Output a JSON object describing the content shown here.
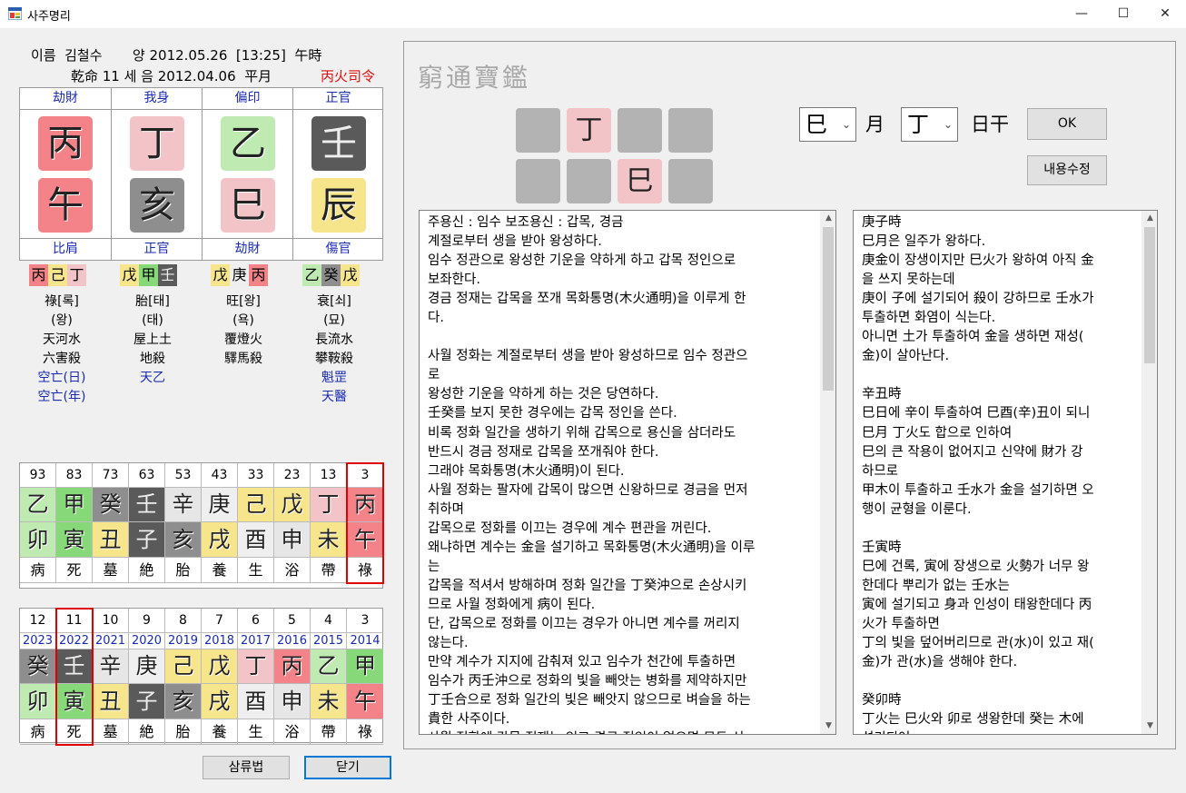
{
  "window": {
    "title": "사주명리",
    "minimize_glyph": "—",
    "maximize_glyph": "☐",
    "close_glyph": "✕"
  },
  "header": {
    "line1": "이름  김철수       양 2012.05.26  [13:25]  午時",
    "line2": "乾命 11 세 음 2012.04.06  平月",
    "line2_right": "丙火司令"
  },
  "pillars": [
    {
      "top": "劫財",
      "stem": "丙",
      "branch": "午",
      "bottom": "比肩",
      "stem_color": "#f38388",
      "branch_color": "#f38388",
      "hidden": [
        {
          "c": "丙",
          "bg": "#f38388"
        },
        {
          "c": "己",
          "bg": "#f6e58a"
        },
        {
          "c": "丁",
          "bg": "#f2c3c7"
        }
      ],
      "info": [
        "祿[록]",
        "(왕)",
        "天河水",
        "六害殺"
      ],
      "info_blue": [
        "空亡(日)",
        "空亡(年)"
      ]
    },
    {
      "top": "我身",
      "stem": "丁",
      "branch": "亥",
      "bottom": "正官",
      "stem_color": "#f2c3c7",
      "branch_color": "#8e8e8e",
      "hidden": [
        {
          "c": "戊",
          "bg": "#f6e58a"
        },
        {
          "c": "甲",
          "bg": "#86d879"
        },
        {
          "c": "壬",
          "bg": "#5a5a5a"
        }
      ],
      "info": [
        "胎[태]",
        "(태)",
        "屋上土",
        "地殺"
      ],
      "info_blue": [
        "天乙"
      ]
    },
    {
      "top": "偏印",
      "stem": "乙",
      "branch": "巳",
      "bottom": "劫財",
      "stem_color": "#bfeab2",
      "branch_color": "#f2c3c7",
      "hidden": [
        {
          "c": "戊",
          "bg": "#f6e58a"
        },
        {
          "c": "庚",
          "bg": "#efefef"
        },
        {
          "c": "丙",
          "bg": "#f38388"
        }
      ],
      "info": [
        "旺[왕]",
        "(욕)",
        "覆燈火",
        "驛馬殺"
      ],
      "info_blue": []
    },
    {
      "top": "正官",
      "stem": "壬",
      "branch": "辰",
      "bottom": "傷官",
      "stem_color": "#5a5a5a",
      "branch_color": "#f6e58a",
      "hidden": [
        {
          "c": "乙",
          "bg": "#bfeab2"
        },
        {
          "c": "癸",
          "bg": "#8e8e8e"
        },
        {
          "c": "戊",
          "bg": "#f6e58a"
        }
      ],
      "info": [
        "衰[쇠]",
        "(묘)",
        "長流水",
        "攀鞍殺"
      ],
      "info_blue": [
        "魁罡",
        "天醫"
      ]
    }
  ],
  "daeun": {
    "ages": [
      "93",
      "83",
      "73",
      "63",
      "53",
      "43",
      "33",
      "23",
      "13",
      "3"
    ],
    "stems": [
      {
        "c": "乙",
        "bg": "#bfeab2"
      },
      {
        "c": "甲",
        "bg": "#86d879"
      },
      {
        "c": "癸",
        "bg": "#8e8e8e"
      },
      {
        "c": "壬",
        "bg": "#5a5a5a"
      },
      {
        "c": "辛",
        "bg": "#e6e6e6"
      },
      {
        "c": "庚",
        "bg": "#efefef"
      },
      {
        "c": "己",
        "bg": "#f6e58a"
      },
      {
        "c": "戊",
        "bg": "#f6e58a"
      },
      {
        "c": "丁",
        "bg": "#f2c3c7"
      },
      {
        "c": "丙",
        "bg": "#f38388"
      }
    ],
    "branches": [
      {
        "c": "卯",
        "bg": "#bfeab2"
      },
      {
        "c": "寅",
        "bg": "#86d879"
      },
      {
        "c": "丑",
        "bg": "#f6e58a"
      },
      {
        "c": "子",
        "bg": "#5a5a5a"
      },
      {
        "c": "亥",
        "bg": "#8e8e8e"
      },
      {
        "c": "戌",
        "bg": "#f6e58a"
      },
      {
        "c": "酉",
        "bg": "#efefef"
      },
      {
        "c": "申",
        "bg": "#e6e6e6"
      },
      {
        "c": "未",
        "bg": "#f6e58a"
      },
      {
        "c": "午",
        "bg": "#f38388"
      }
    ],
    "stages": [
      "病",
      "死",
      "墓",
      "絶",
      "胎",
      "養",
      "生",
      "浴",
      "帶",
      "祿"
    ]
  },
  "seun": {
    "ages": [
      "12",
      "11",
      "10",
      "9",
      "8",
      "7",
      "6",
      "5",
      "4",
      "3"
    ],
    "years": [
      "2023",
      "2022",
      "2021",
      "2020",
      "2019",
      "2018",
      "2017",
      "2016",
      "2015",
      "2014"
    ],
    "stems": [
      {
        "c": "癸",
        "bg": "#8e8e8e"
      },
      {
        "c": "壬",
        "bg": "#5a5a5a"
      },
      {
        "c": "辛",
        "bg": "#e6e6e6"
      },
      {
        "c": "庚",
        "bg": "#efefef"
      },
      {
        "c": "己",
        "bg": "#f6e58a"
      },
      {
        "c": "戊",
        "bg": "#f6e58a"
      },
      {
        "c": "丁",
        "bg": "#f2c3c7"
      },
      {
        "c": "丙",
        "bg": "#f38388"
      },
      {
        "c": "乙",
        "bg": "#bfeab2"
      },
      {
        "c": "甲",
        "bg": "#86d879"
      }
    ],
    "branches": [
      {
        "c": "卯",
        "bg": "#bfeab2"
      },
      {
        "c": "寅",
        "bg": "#86d879"
      },
      {
        "c": "丑",
        "bg": "#f6e58a"
      },
      {
        "c": "子",
        "bg": "#5a5a5a"
      },
      {
        "c": "亥",
        "bg": "#8e8e8e"
      },
      {
        "c": "戌",
        "bg": "#f6e58a"
      },
      {
        "c": "酉",
        "bg": "#efefef"
      },
      {
        "c": "申",
        "bg": "#e6e6e6"
      },
      {
        "c": "未",
        "bg": "#f6e58a"
      },
      {
        "c": "午",
        "bg": "#f38388"
      }
    ],
    "stages": [
      "病",
      "死",
      "墓",
      "絶",
      "胎",
      "養",
      "生",
      "浴",
      "帶",
      "祿"
    ]
  },
  "buttons": {
    "samryu": "삼류법",
    "close": "닫기",
    "ok": "OK",
    "edit": "내용수정"
  },
  "right": {
    "logo": "窮通寶鑑",
    "stem_squares": [
      "",
      "丁",
      "",
      ""
    ],
    "branch_squares": [
      "",
      "",
      "巳",
      ""
    ],
    "month_select": "巳",
    "month_label": "月",
    "daystem_select": "丁",
    "daystem_label": "日干",
    "main_text": "주용신 : 임수 보조용신 : 갑목, 경금\n계절로부터 생을 받아 왕성하다.\n임수 정관으로 왕성한 기운을 약하게 하고 갑목 정인으로\n보좌한다.\n경금 정재는 갑목을 쪼개 목화통명(木火通明)을 이루게 한\n다.\n\n사월 정화는 계절로부터 생을 받아 왕성하므로 임수 정관으\n로\n왕성한 기운을 약하게 하는 것은 당연하다.\n壬癸를 보지 못한 경우에는 갑목 정인을 쓴다.\n비록 정화 일간을 생하기 위해 갑목으로 용신을 삼더라도\n반드시 경금 정재로 갑목을 쪼개줘야 한다.\n그래야 목화통명(木火通明)이 된다.\n사월 정화는 팔자에 갑목이 많으면 신왕하므로 경금을 먼저\n취하며\n갑목으로 정화를 이끄는 경우에 계수 편관을 꺼린다.\n왜냐하면 계수는 金을 설기하고 목화통명(木火通明)을 이루\n는\n갑목을 적셔서 방해하며 정화 일간을 丁癸沖으로 손상시키\n므로 사월 정화에게 病이 된다.\n단, 갑목으로 정화를 이끄는 경우가 아니면 계수를 꺼리지\n않는다.\n만약 계수가 지지에 감춰져 있고 임수가 천간에 투출하면\n임수가 丙壬沖으로 정화의 빛을 빼앗는 병화를 제약하지만\n丁壬合으로 정화 일간의 빛은 빼앗지 않으므로 벼슬을 하는\n貴한 사주이다.\n사월 정화에 갑목 정재는 있고 경금 정인이 없으면 모두 신",
    "side_text": "庚子時\n巳月은 일주가 왕하다.\n庚金이 장생이지만 巳火가 왕하여 아직 金\n을 쓰지 못하는데\n庚이 子에 설기되어 殺이 강하므로 壬水가\n투출하면 화염이 식는다.\n아니면 土가 투출하여 金을 생하면 재성(\n金)이 살아난다.\n\n辛丑時\n巳日에 辛이 투출하여 巳酉(辛)丑이 되니\n巳月 丁火도 합으로 인하여\n巳의 큰 작용이 없어지고 신약에 財가 강\n하므로\n甲木이 투출하고 壬水가 金을 설기하면 오\n행이 균형을 이룬다.\n\n壬寅時\n巳에 건록, 寅에 장생으로 火勢가 너무 왕\n한데다 뿌리가 없는 壬水는\n寅에 설기되고 身과 인성이 태왕한데다 丙\n火가 투출하면\n丁의 빛을 덮어버리므로 관(水)이 있고 재(\n金)가 관(水)을 생해야 한다.\n\n癸卯時\n丁火는 巳火와 卯로 생왕한데 癸는 木에\n설기되어"
  }
}
